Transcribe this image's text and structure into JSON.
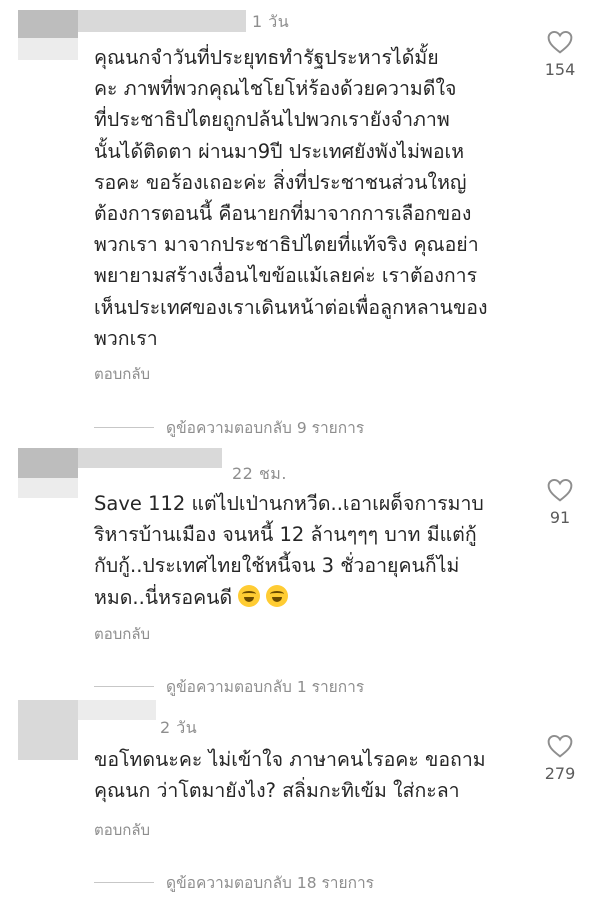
{
  "comments": [
    {
      "time": "1 วัน",
      "text": "คุณนกจำวันที่ประยุทธทำรัฐประหารได้มั้ย\nคะ ภาพที่พวกคุณไชโยโห่ร้องด้วยความดีใจ\nที่ประชาธิปไตยถูกปล้นไปพวกเรายังจำภาพ\nนั้นได้ติดตา ผ่านมา9ปี ประเทศยังพังไม่พอเห\nรอคะ ขอร้องเถอะค่ะ สิ่งที่ประชาชนส่วนใหญ่\nต้องการตอนนี้ คือนายกที่มาจากการเลือกของ\nพวกเรา มาจากประชาธิปไตยที่แท้จริง คุณอย่า\nพยายามสร้างเงื่อนไขข้อแม้เลยค่ะ เราต้องการ\nเห็นประเทศของเราเดินหน้าต่อเพื่อลูกหลานของ\nพวกเรา",
      "reply_label": "ตอบกลับ",
      "likes": "154",
      "view_replies": "ดูข้อความตอบกลับ 9 รายการ"
    },
    {
      "time": "22 ชม.",
      "text": "Save 112 แต่ไปเป่านกหวีด..เอาเผด็จการมาบ\nริหารบ้านเมือง จนหนี้ 12 ล้านๆๆๆ บาท มีแต่กู้\nกับกู้..ประเทศไทยใช้หนี้จน 3 ชั่วอายุคนก็ไม่\nหมด..นี่หรอคนดี",
      "reply_label": "ตอบกลับ",
      "likes": "91",
      "view_replies": "ดูข้อความตอบกลับ 1 รายการ"
    },
    {
      "time": "2 วัน",
      "text": "ขอโทดนะคะ ไม่เข้าใจ ภาษาคนไรอคะ ขอถาม\nคุณนก ว่าโตมายังไง? สลิ่มกะทิเข้ม ใส่กะลา",
      "reply_label": "ตอบกลับ",
      "likes": "279",
      "view_replies": "ดูข้อความตอบกลับ 18 รายการ"
    }
  ],
  "icons": {
    "like": "heart-outline-icon",
    "emoji": "face-with-tears-of-joy-icon"
  }
}
